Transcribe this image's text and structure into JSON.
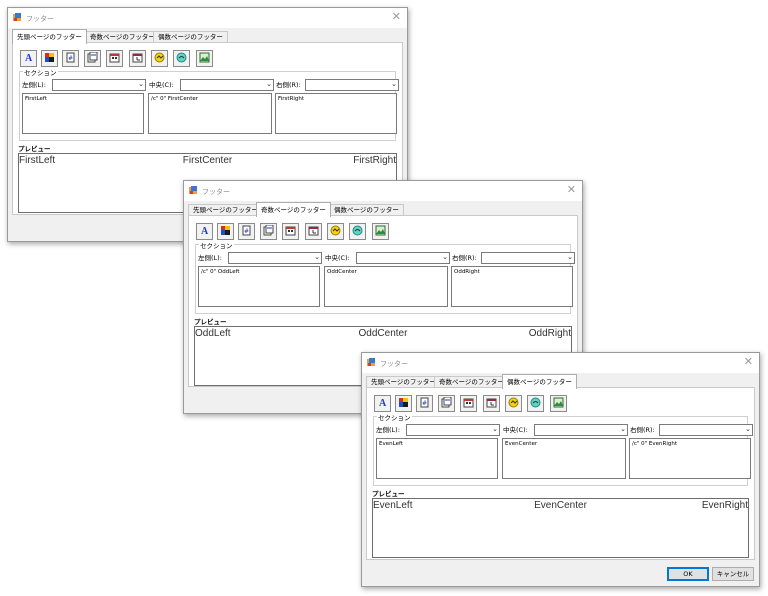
{
  "dialogs": [
    {
      "title": "フッター",
      "tabs": [
        "先頭ページのフッター",
        "奇数ページのフッター",
        "偶数ページのフッター"
      ],
      "active_tab": 0,
      "section_label": "セクション",
      "left_label": "左側(L):",
      "center_label": "中央(C):",
      "right_label": "右側(R):",
      "left_text": "FirstLeft",
      "center_text": "/c\" 0\" FirstCenter",
      "right_text": "FirstRight",
      "preview_label": "プレビュー",
      "preview_left": "FirstLeft",
      "preview_center": "FirstCenter",
      "preview_right": "FirstRight"
    },
    {
      "title": "フッター",
      "tabs": [
        "先頭ページのフッター",
        "奇数ページのフッター",
        "偶数ページのフッター"
      ],
      "active_tab": 1,
      "section_label": "セクション",
      "left_label": "左側(L):",
      "center_label": "中央(C):",
      "right_label": "右側(R):",
      "left_text": "/c\" 0\" OddLeft",
      "center_text": "OddCenter",
      "right_text": "OddRight",
      "preview_label": "プレビュー",
      "preview_left": "OddLeft",
      "preview_center": "OddCenter",
      "preview_right": "OddRight"
    },
    {
      "title": "フッター",
      "tabs": [
        "先頭ページのフッター",
        "奇数ページのフッター",
        "偶数ページのフッター"
      ],
      "active_tab": 2,
      "section_label": "セクション",
      "left_label": "左側(L):",
      "center_label": "中央(C):",
      "right_label": "右側(R):",
      "left_text": "EvenLeft",
      "center_text": "EvenCenter",
      "right_text": "/c\" 0\" EvenRight",
      "preview_label": "プレビュー",
      "preview_left": "EvenLeft",
      "preview_center": "EvenCenter",
      "preview_right": "EvenRight",
      "ok_label": "OK",
      "cancel_label": "キャンセル"
    }
  ],
  "toolbar_icons": [
    "font-icon",
    "color-icon",
    "page-number-icon",
    "page-count-icon",
    "date-icon",
    "time-icon",
    "file-path-icon",
    "file-name-icon",
    "picture-icon"
  ],
  "colors": {
    "window_bg": "#f0f0f0",
    "accent": "#0078d7",
    "title_text": "#8a8a8a"
  }
}
